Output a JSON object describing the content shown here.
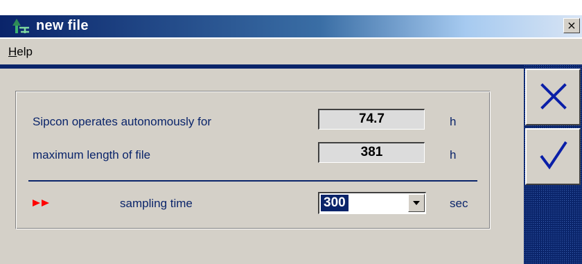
{
  "window": {
    "title": "new file",
    "close_label": "×"
  },
  "menu": {
    "help_mnemonic": "H",
    "help_rest": "elp"
  },
  "form": {
    "autonomy": {
      "label": "Sipcon operates autonomously for",
      "value": "74.7",
      "unit": "h"
    },
    "max_length": {
      "label": "maximum length of file",
      "value": "381",
      "unit": "h"
    },
    "sampling": {
      "label": "sampling time",
      "value": "300",
      "unit": "sec",
      "marker_icon": "double-arrow-right-icon"
    }
  },
  "side_buttons": {
    "cancel_icon": "cross-icon",
    "ok_icon": "checkmark-icon"
  },
  "colors": {
    "title_gradient_start": "#0a246a",
    "title_gradient_end": "#d8e4f4",
    "label_text": "#0a246a",
    "panel_bg": "#d4d0c8",
    "marker_red": "#ff0000",
    "side_panel": "#0a246a",
    "icon_blue": "#0a1fa8"
  }
}
